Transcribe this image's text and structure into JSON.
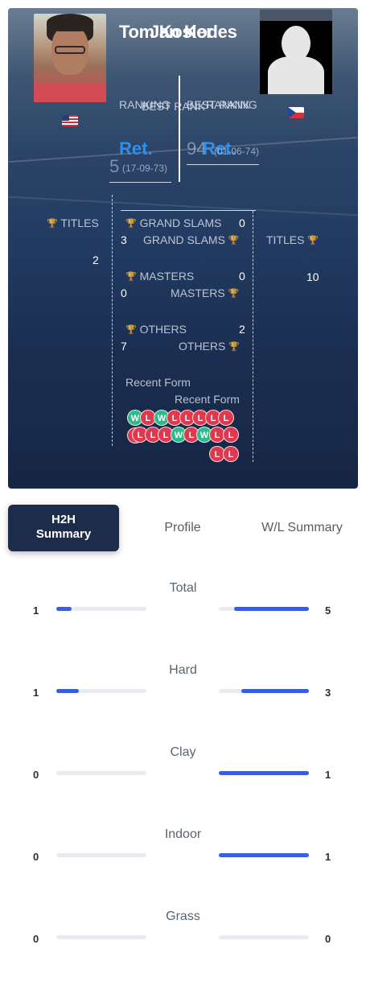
{
  "players": {
    "left": {
      "name": "Tom Kosler",
      "flag": "us-flag",
      "best_rank_label": "BEST RANK",
      "best_rank_value": "5",
      "best_rank_date": "(17-09-73)",
      "rank_label": "RANKING",
      "rank_value": "Ret.",
      "titles_label": "TITLES",
      "titles_value": "2",
      "grand_slams_label": "GRAND SLAMS",
      "grand_slams_value": "3",
      "masters_label": "MASTERS",
      "masters_value": "0",
      "others_label": "OTHERS",
      "others_value": "7",
      "recent_form": [
        "W",
        "L",
        "W",
        "L",
        "L",
        "L",
        "L",
        "L"
      ]
    },
    "right": {
      "name": "Jan Kodes",
      "flag": "cz-flag",
      "best_rank_label": "BEST RANK",
      "best_rank_value": "94",
      "best_rank_date": "(01-06-74)",
      "rank_label": "RANKING",
      "rank_value": "Ret.",
      "titles_label": "TITLES",
      "titles_value": "10",
      "grand_slams_label": "GRAND SLAMS",
      "grand_slams_value": "0",
      "masters_label": "MASTERS",
      "masters_value": "0",
      "others_label": "OTHERS",
      "others_value": "2",
      "recent_form": [
        "L",
        "L",
        "L",
        "L",
        "W",
        "L",
        "W",
        "L",
        "L",
        "L",
        "L"
      ]
    }
  },
  "overlay_name": "Tom Kosler",
  "overlay_name_right": "Jan Kodes",
  "recent_form_label": "Recent Form",
  "tabs": [
    {
      "label": "H2H Summary",
      "active": true
    },
    {
      "label": "Profile",
      "active": false
    },
    {
      "label": "W/L Summary",
      "active": false
    }
  ],
  "h2h": [
    {
      "label": "Total",
      "left": "1",
      "right": "5",
      "left_frac": 0.17,
      "right_frac": 0.83
    },
    {
      "label": "Hard",
      "left": "1",
      "right": "3",
      "left_frac": 0.25,
      "right_frac": 0.75
    },
    {
      "label": "Clay",
      "left": "0",
      "right": "1",
      "left_frac": 0.0,
      "right_frac": 1.0
    },
    {
      "label": "Indoor",
      "left": "0",
      "right": "1",
      "left_frac": 0.0,
      "right_frac": 1.0
    },
    {
      "label": "Grass",
      "left": "0",
      "right": "0",
      "left_frac": 0.0,
      "right_frac": 0.0
    }
  ],
  "colors": {
    "accent": "#3b5ddb",
    "win": "#2fba8a",
    "loss": "#e0384f",
    "ret": "#2f8fea",
    "tab_active_bg": "#1c2c4a"
  }
}
